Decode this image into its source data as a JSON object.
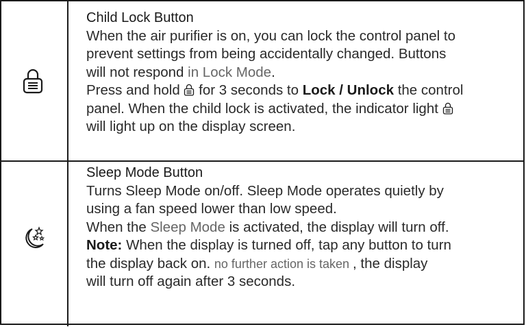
{
  "rows": {
    "lock": {
      "icon": "padlock-icon",
      "title": "Child Lock Button",
      "l1": "When the air purifier is on, you can lock the control panel to",
      "l2": "prevent settings from being accidentally changed. Buttons",
      "l3a": "will not respond",
      "l3b": " in Lock Mode",
      "l3c": ".",
      "l4a": "Press and hold ",
      "l4b": " for 3 seconds to ",
      "l4c": "Lock / Unlock",
      "l4d": " the control",
      "l5a": "panel. When the child lock is activated, the indicator light ",
      "l6": "will light up on the display screen."
    },
    "sleep": {
      "icon": "moon-stars-icon",
      "title": "Sleep Mode Button",
      "l1": "Turns Sleep Mode on/off. Sleep Mode operates quietly by",
      "l2": "using a fan speed lower than low speed.",
      "l3a": "When the ",
      "l3b": "Sleep Mode",
      "l3c": " is activated, the display will  turn off.",
      "l4a": "Note:",
      "l4b": " When the display is turned off, tap any button to turn",
      "l5a": "the display back on. ",
      "l5b": "no further action is taken ",
      "l5c": ", the display",
      "l6": "will turn off again after 3 seconds."
    }
  }
}
